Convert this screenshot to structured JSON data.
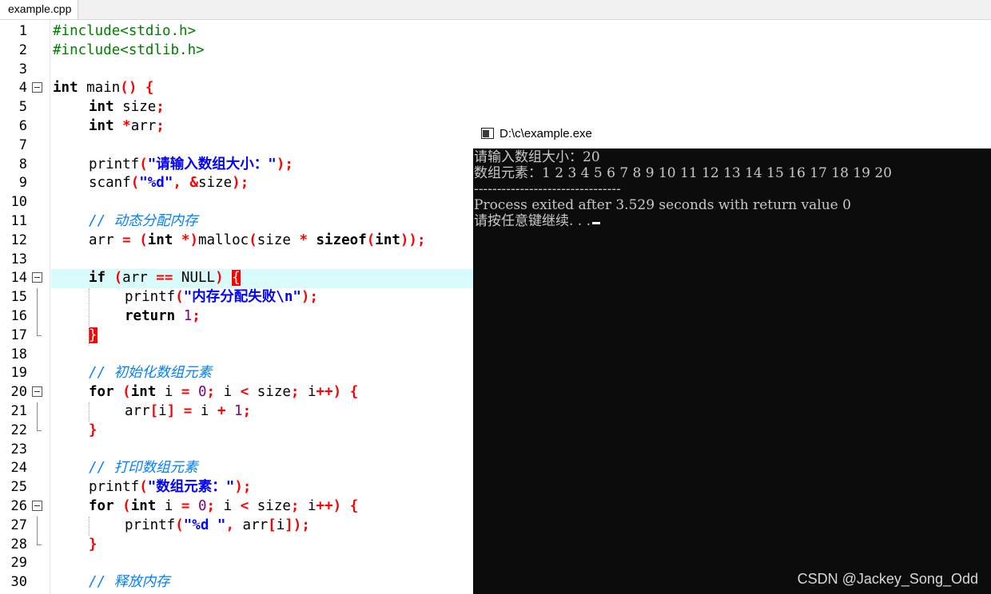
{
  "tab": {
    "label": "example.cpp"
  },
  "editor": {
    "lines": [
      {
        "n": "1",
        "inc": "#include",
        "hdr": "<stdio.h>"
      },
      {
        "n": "2",
        "inc": "#include",
        "hdr": "<stdlib.h>"
      },
      {
        "n": "3"
      },
      {
        "n": "4",
        "t": "int",
        "fn": " main",
        "p1": "()",
        "p2": " {"
      },
      {
        "n": "5",
        "t": "int",
        "rest": " size",
        "semi": ";"
      },
      {
        "n": "6",
        "t": "int",
        "op": " *",
        "rest": "arr",
        "semi": ";"
      },
      {
        "n": "7"
      },
      {
        "n": "8",
        "fn": "printf",
        "p1": "(",
        "s": "\"请输入数组大小：\"",
        "p2": ");"
      },
      {
        "n": "9",
        "fn": "scanf",
        "p1": "(",
        "s": "\"%d\"",
        "p2": ", &",
        "rest": "size",
        "p3": ");"
      },
      {
        "n": "10"
      },
      {
        "n": "11",
        "cm": "// 动态分配内存"
      },
      {
        "n": "12",
        "a": "arr",
        "b": " = (",
        "c": "int",
        "d": " *)",
        "e": "malloc",
        "f": "(",
        "g": "size",
        "h": " * ",
        "i": "sizeof",
        "j": "(",
        "k": "int",
        "l": "));"
      },
      {
        "n": "13"
      },
      {
        "n": "14",
        "kw": "if",
        "p1": " (",
        "rest": "arr",
        "op": " ==",
        "rest2": " NULL",
        "p2": ") ",
        "br": "{"
      },
      {
        "n": "15",
        "fn": "printf",
        "p1": "(",
        "s": "\"内存分配失败\\n\"",
        "p2": ");"
      },
      {
        "n": "16",
        "kw": "return",
        "num": " 1",
        "semi": ";"
      },
      {
        "n": "17",
        "br": "}"
      },
      {
        "n": "18"
      },
      {
        "n": "19",
        "cm": "// 初始化数组元素"
      },
      {
        "n": "20",
        "kw": "for",
        "p1": " (",
        "t": "int",
        "a": " i",
        "b": " =",
        "num": " 0",
        "c": ";",
        "d": " i",
        "e": " <",
        "f": " size",
        "g": ";",
        "h": " i",
        "i": "++",
        "j": ") {"
      },
      {
        "n": "21",
        "a": "arr",
        "b": "[",
        "c": "i",
        "d": "]",
        "e": " =",
        "f": " i",
        "g": " +",
        "num": " 1",
        "h": ";"
      },
      {
        "n": "22",
        "br": "}"
      },
      {
        "n": "23"
      },
      {
        "n": "24",
        "cm": "// 打印数组元素"
      },
      {
        "n": "25",
        "fn": "printf",
        "p1": "(",
        "s": "\"数组元素：\"",
        "p2": ");"
      },
      {
        "n": "26",
        "kw": "for",
        "p1": " (",
        "t": "int",
        "a": " i",
        "b": " =",
        "num": " 0",
        "c": ";",
        "d": " i",
        "e": " <",
        "f": " size",
        "g": ";",
        "h": " i",
        "i": "++",
        "j": ") {"
      },
      {
        "n": "27",
        "fn": "printf",
        "p1": "(",
        "s": "\"%d \"",
        "p2": ",",
        "a": " arr",
        "b": "[",
        "c": "i",
        "d": "]);"
      },
      {
        "n": "28",
        "br": "}"
      },
      {
        "n": "29"
      },
      {
        "n": "30",
        "cm": "// 释放内存"
      }
    ]
  },
  "console": {
    "title": "D:\\c\\example.exe",
    "lines": [
      "请输入数组大小：20",
      "数组元素：1 2 3 4 5 6 7 8 9 10 11 12 13 14 15 16 17 18 19 20",
      "--------------------------------",
      "Process exited after 3.529 seconds with return value 0",
      "请按任意键继续. . ."
    ]
  },
  "watermark": "CSDN @Jackey_Song_Odd"
}
